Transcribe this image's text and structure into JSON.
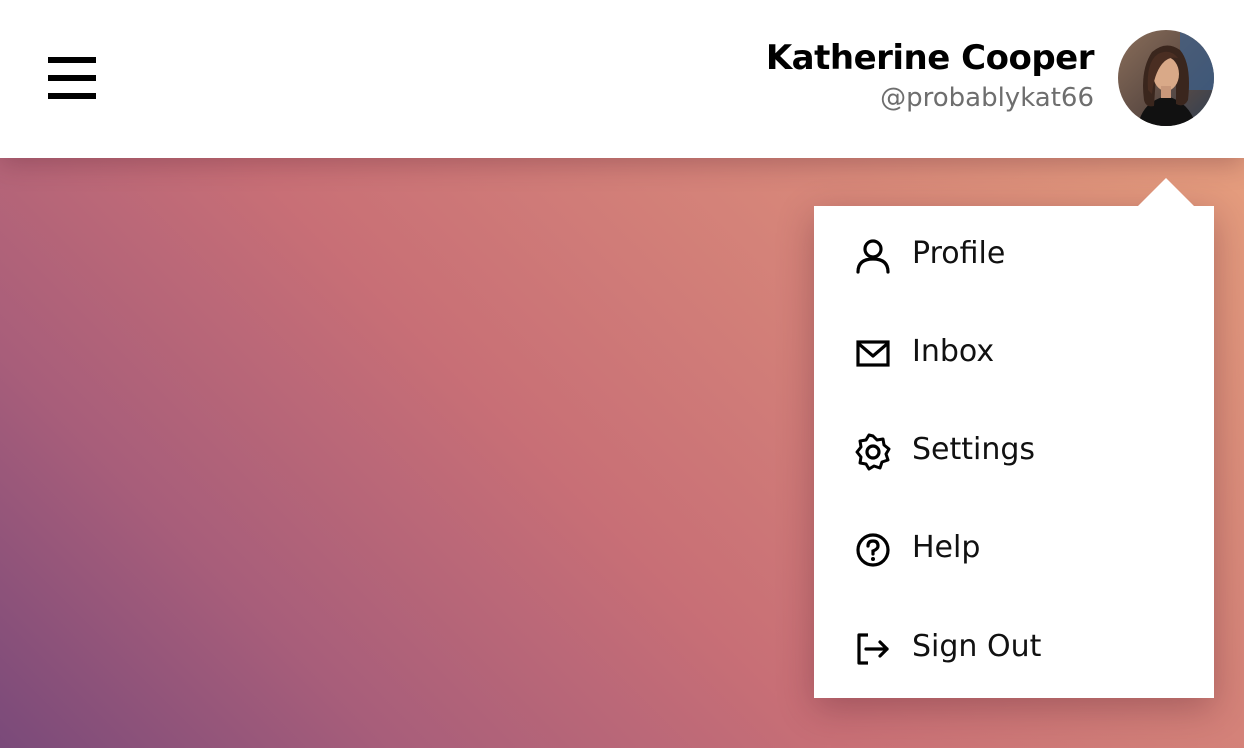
{
  "header": {
    "user": {
      "name": "Katherine Cooper",
      "handle": "@probablykat66"
    }
  },
  "menu": {
    "items": [
      {
        "label": "Profile",
        "icon": "user-icon"
      },
      {
        "label": "Inbox",
        "icon": "envelope-icon"
      },
      {
        "label": "Settings",
        "icon": "gear-icon"
      },
      {
        "label": "Help",
        "icon": "question-circle-icon"
      },
      {
        "label": "Sign Out",
        "icon": "sign-out-icon"
      }
    ]
  },
  "colors": {
    "background_gradient": [
      "#eaa57f",
      "#d98a7a",
      "#c86f76",
      "#a85e7a",
      "#7a4a7a"
    ],
    "header_bg": "#ffffff",
    "menu_bg": "#ffffff",
    "text_primary": "#000000",
    "text_secondary": "#6e6e6e"
  }
}
